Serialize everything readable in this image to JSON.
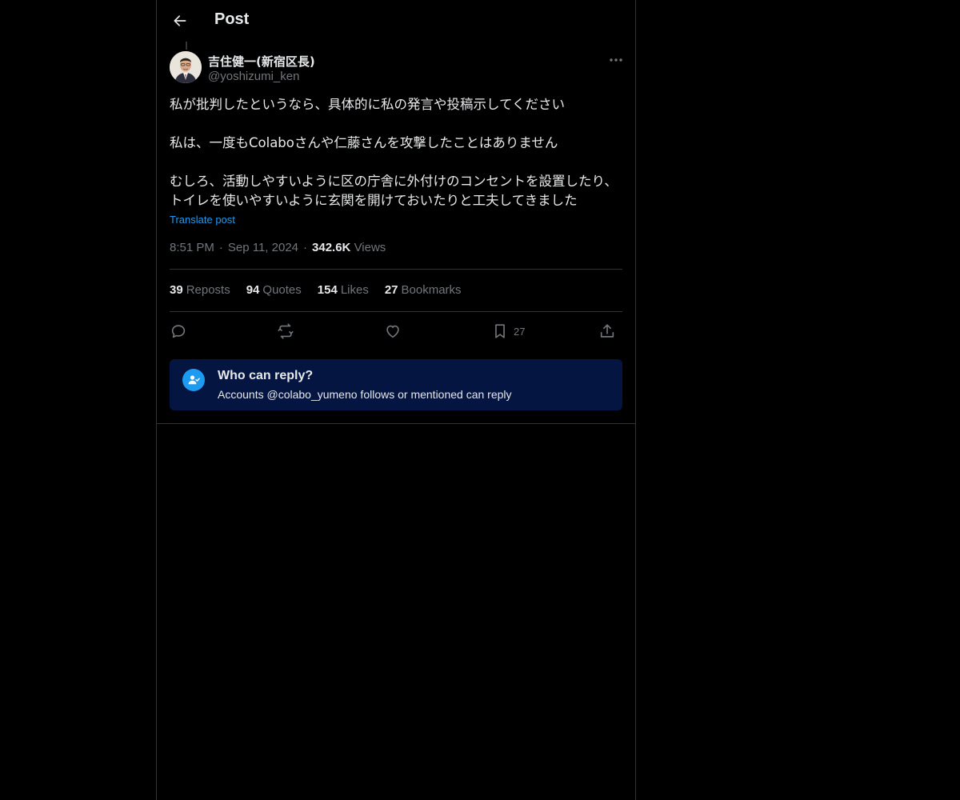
{
  "header": {
    "title": "Post",
    "back_icon": "arrow-left-icon"
  },
  "author": {
    "name": "吉住健一(新宿区長)",
    "handle": "@yoshizumi_ken"
  },
  "post": {
    "paragraphs": [
      "私が批判したというなら、具体的に私の発言や投稿示してください",
      "私は、一度もColaboさんや仁藤さんを攻撃したことはありません",
      "むしろ、活動しやすいように区の庁舎に外付けのコンセントを設置したり、トイレを使いやすいように玄関を開けておいたりと工夫してきました"
    ],
    "translate_label": "Translate post",
    "time": "8:51 PM",
    "date": "Sep 11, 2024",
    "views_count": "342.6K",
    "views_label": "Views",
    "separator": "·"
  },
  "stats": {
    "reposts": {
      "count": "39",
      "label": "Reposts"
    },
    "quotes": {
      "count": "94",
      "label": "Quotes"
    },
    "likes": {
      "count": "154",
      "label": "Likes"
    },
    "bookmarks": {
      "count": "27",
      "label": "Bookmarks"
    }
  },
  "actions": {
    "reply_icon": "reply-icon",
    "repost_icon": "repost-icon",
    "like_icon": "heart-icon",
    "bookmark_icon": "bookmark-icon",
    "bookmark_count": "27",
    "share_icon": "share-icon"
  },
  "reply_restriction": {
    "title": "Who can reply?",
    "description": "Accounts @colabo_yumeno follows or mentioned can reply"
  },
  "colors": {
    "background": "#000000",
    "text": "#e7e9ea",
    "muted": "#71767b",
    "accent": "#1d9bf0",
    "border": "#2f3336",
    "reply_box": "#031540"
  }
}
